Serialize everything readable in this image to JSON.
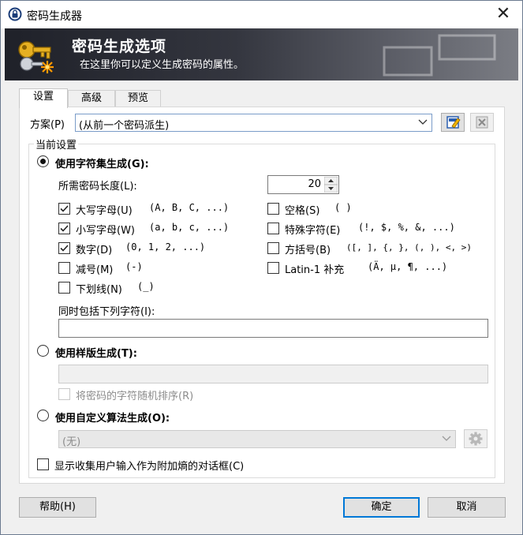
{
  "window": {
    "title": "密码生成器",
    "close_glyph": "✕"
  },
  "banner": {
    "title": "密码生成选项",
    "subtitle": "在这里你可以定义生成密码的属性。"
  },
  "tabs": [
    {
      "label": "设置"
    },
    {
      "label": "高级"
    },
    {
      "label": "预览"
    }
  ],
  "profile": {
    "label": "方案(P)",
    "value": "(从前一个密码派生)"
  },
  "group": {
    "label": "当前设置"
  },
  "charset": {
    "radio_label": "使用字符集生成(G):",
    "length_label": "所需密码长度(L):",
    "length_value": "20",
    "options": [
      {
        "label": "大写字母(U)",
        "sample": "(A, B, C, ...)",
        "checked": true
      },
      {
        "label": "空格(S)",
        "sample": "( )",
        "checked": false
      },
      {
        "label": "小写字母(W)",
        "sample": "(a, b, c, ...)",
        "checked": true
      },
      {
        "label": "特殊字符(E)",
        "sample": "(!, $, %, &, ...)",
        "checked": false
      },
      {
        "label": "数字(D)",
        "sample": "(0, 1, 2, ...)",
        "checked": true
      },
      {
        "label": "方括号(B)",
        "sample": "([, ], {, }, (, ), <, >)",
        "checked": false
      },
      {
        "label": "减号(M)",
        "sample": "(-)",
        "checked": false
      },
      {
        "label": "Latin-1 补充",
        "sample": "(Ä, µ, ¶, ...)",
        "checked": false
      },
      {
        "label": "下划线(N)",
        "sample": "(_)",
        "checked": false
      }
    ],
    "include_label": "同时包括下列字符(I):",
    "include_value": ""
  },
  "pattern": {
    "radio_label": "使用样版生成(T):",
    "shuffle_label": "将密码的字符随机排序(R)"
  },
  "custom": {
    "radio_label": "使用自定义算法生成(O):",
    "algorithm_value": "(无)"
  },
  "entropy_label": "显示收集用户输入作为附加熵的对话框(C)",
  "buttons": {
    "help": "帮助(H)",
    "ok": "确定",
    "cancel": "取消"
  },
  "colors": {
    "accent": "#0078d7",
    "banner_dark": "#1f2129"
  }
}
